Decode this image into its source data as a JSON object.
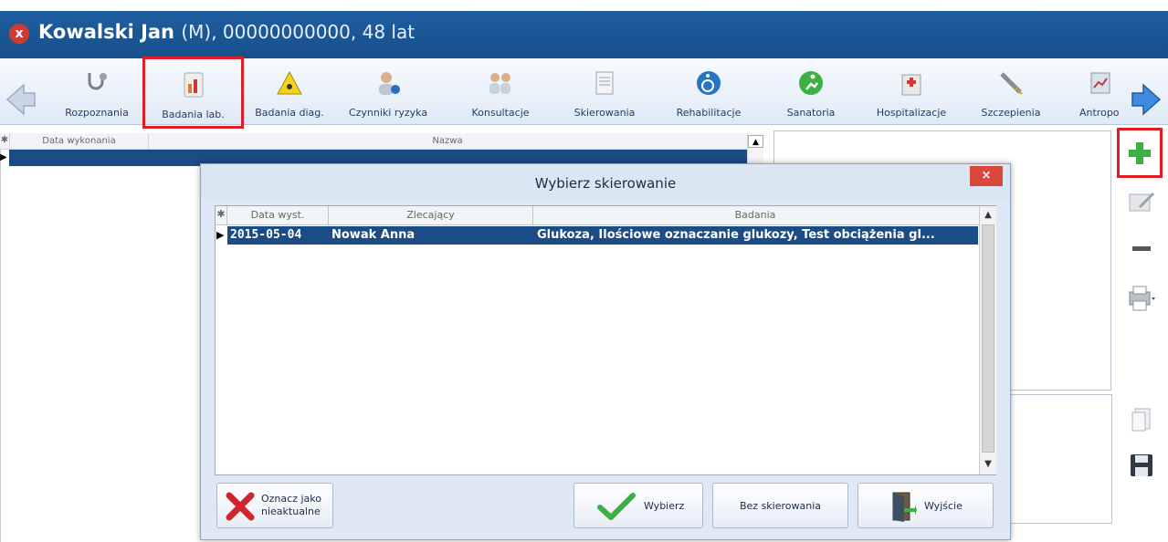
{
  "patient": {
    "close_symbol": "x",
    "name": "Kowalski Jan",
    "details": "(M), 00000000000, 48 lat"
  },
  "toolbar": {
    "items": [
      {
        "label": "Rozpoznania",
        "icon": "stethoscope-icon"
      },
      {
        "label": "Badania lab.",
        "icon": "lab-chart-icon"
      },
      {
        "label": "Badania diag.",
        "icon": "radiation-warning-icon"
      },
      {
        "label": "Czynniki ryzyka",
        "icon": "person-info-icon"
      },
      {
        "label": "Konsultacje",
        "icon": "doctors-icon"
      },
      {
        "label": "Skierowania",
        "icon": "document-icon"
      },
      {
        "label": "Rehabilitacje",
        "icon": "wheelchair-icon"
      },
      {
        "label": "Sanatoria",
        "icon": "runner-icon"
      },
      {
        "label": "Hospitalizacje",
        "icon": "hospital-icon"
      },
      {
        "label": "Szczepienia",
        "icon": "syringe-icon"
      },
      {
        "label": "Antropo",
        "icon": "chart-book-icon"
      }
    ],
    "selected": "Badania lab."
  },
  "main_grid": {
    "columns": [
      "Data wykonania",
      "Nazwa"
    ]
  },
  "dialog": {
    "title": "Wybierz skierowanie",
    "close_symbol": "×",
    "columns": [
      "Data wyst.",
      "Zlecający",
      "Badania"
    ],
    "rows": [
      {
        "date": "2015-05-04",
        "ordering": "Nowak Anna",
        "tests": "Glukoza, Ilościowe oznaczanie glukozy, Test obciążenia gl..."
      }
    ],
    "buttons": {
      "mark_outdated": "Oznacz jako\nnieaktualne",
      "select": "Wybierz",
      "no_referral": "Bez skierowania",
      "exit": "Wyjście"
    }
  },
  "colors": {
    "header_bg": "#1f5ea0",
    "selection": "#1b4c86",
    "highlight": "#e01e26",
    "accent_green": "#3cb043"
  }
}
